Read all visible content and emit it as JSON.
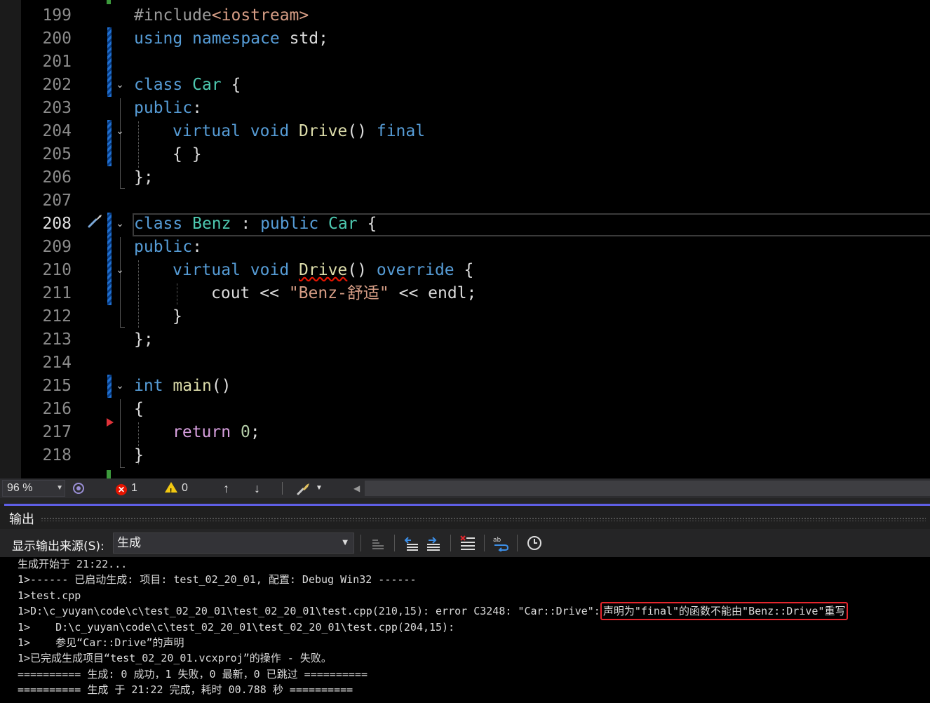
{
  "editor": {
    "current_line": "208",
    "lines": [
      {
        "n": "199",
        "code": "#include<iostream>"
      },
      {
        "n": "200",
        "code": "using namespace std;"
      },
      {
        "n": "201",
        "code": ""
      },
      {
        "n": "202",
        "code": "class Car {"
      },
      {
        "n": "203",
        "code": "public:"
      },
      {
        "n": "204",
        "code": "virtual void Drive() final"
      },
      {
        "n": "205",
        "code": "{ }"
      },
      {
        "n": "206",
        "code": "};"
      },
      {
        "n": "207",
        "code": ""
      },
      {
        "n": "208",
        "code": "class Benz : public Car {"
      },
      {
        "n": "209",
        "code": "public:"
      },
      {
        "n": "210",
        "code": "virtual void Drive() override {"
      },
      {
        "n": "211",
        "code": "cout << \"Benz-舒适\" << endl;"
      },
      {
        "n": "212",
        "code": "}"
      },
      {
        "n": "213",
        "code": "};"
      },
      {
        "n": "214",
        "code": ""
      },
      {
        "n": "215",
        "code": "int main()"
      },
      {
        "n": "216",
        "code": "{"
      },
      {
        "n": "217",
        "code": "return 0;"
      },
      {
        "n": "218",
        "code": "}"
      }
    ],
    "tokens": {
      "l199": {
        "a": "#include",
        "b": "<iostream>"
      },
      "l200": {
        "a": "using",
        "b": "namespace",
        "c": "std;"
      },
      "l202": {
        "a": "class",
        "b": "Car",
        "c": "{"
      },
      "l203": {
        "a": "public",
        "b": ":"
      },
      "l204": {
        "a": "virtual",
        "b": "void",
        "c": "Drive",
        "d": "()",
        "e": "final"
      },
      "l205": {
        "a": "{ }"
      },
      "l206": {
        "a": "};"
      },
      "l208": {
        "a": "class",
        "b": "Benz",
        "c": ":",
        "d": "public",
        "e": "Car",
        "f": "{"
      },
      "l209": {
        "a": "public",
        "b": ":"
      },
      "l210": {
        "a": "virtual",
        "b": "void",
        "c": "Drive",
        "d": "()",
        "e": "override",
        "f": "{"
      },
      "l211": {
        "a": "cout",
        "b": "<<",
        "c": "\"Benz-舒适\"",
        "d": "<<",
        "e": "endl;"
      },
      "l212": {
        "a": "}"
      },
      "l213": {
        "a": "};"
      },
      "l215": {
        "a": "int",
        "b": "main",
        "c": "()"
      },
      "l216": {
        "a": "{"
      },
      "l217": {
        "a": "return",
        "b": "0",
        ";": ";"
      },
      "l218": {
        "a": "}"
      }
    }
  },
  "statusbar": {
    "zoom": "96 %",
    "errors": "1",
    "warnings": "0"
  },
  "output": {
    "title": "输出",
    "source_label": "显示输出来源(S):",
    "source_value": "生成",
    "lines": [
      "生成开始于 21:22...",
      "1>------ 已启动生成: 项目: test_02_20_01, 配置: Debug Win32 ------",
      "1>test.cpp",
      "1>D:\\c_yuyan\\code\\c\\test_02_20_01\\test_02_20_01\\test.cpp(210,15): error C3248: \"Car::Drive\":",
      "声明为\"final\"的函数不能由\"Benz::Drive\"重写",
      "1>    D:\\c_yuyan\\code\\c\\test_02_20_01\\test_02_20_01\\test.cpp(204,15):",
      "1>    参见“Car::Drive”的声明",
      "1>已完成生成项目“test_02_20_01.vcxproj”的操作 - 失败。",
      "========== 生成: 0 成功，1 失败，0 最新，0 已跳过 ==========",
      "========== 生成 于 21:22 完成，耗时 00.788 秒 =========="
    ]
  },
  "colors": {
    "keyword": "#569cd6",
    "type": "#4ec9b0",
    "function": "#dcdcaa",
    "string": "#d69d85",
    "error": "#e51400",
    "accent": "#5f5fe6"
  }
}
